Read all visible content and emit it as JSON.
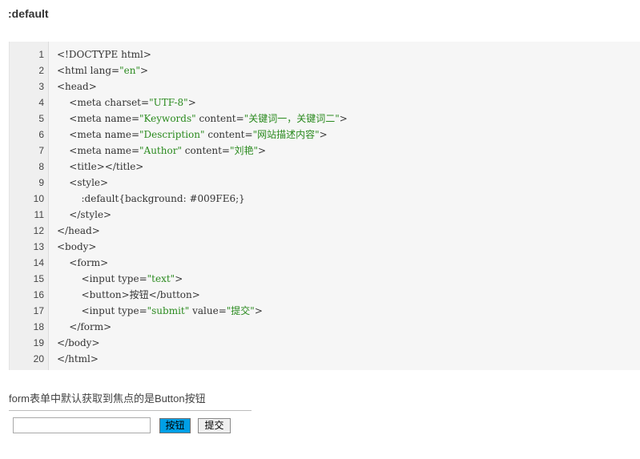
{
  "heading": ":default",
  "code_lines": [
    {
      "n": "1",
      "parts": [
        {
          "t": "<!DOCTYPE html>",
          "c": "tag"
        }
      ]
    },
    {
      "n": "2",
      "parts": [
        {
          "t": "<html lang=",
          "c": "tag"
        },
        {
          "t": "\"en\"",
          "c": "str"
        },
        {
          "t": ">",
          "c": "tag"
        }
      ]
    },
    {
      "n": "3",
      "parts": [
        {
          "t": "<head>",
          "c": "tag"
        }
      ]
    },
    {
      "n": "4",
      "parts": [
        {
          "t": "    <meta charset=",
          "c": "tag"
        },
        {
          "t": "\"UTF-8\"",
          "c": "str"
        },
        {
          "t": ">",
          "c": "tag"
        }
      ]
    },
    {
      "n": "5",
      "parts": [
        {
          "t": "    <meta name=",
          "c": "tag"
        },
        {
          "t": "\"Keywords\"",
          "c": "str"
        },
        {
          "t": " content=",
          "c": "tag"
        },
        {
          "t": "\"关键词一，关键词二\"",
          "c": "str"
        },
        {
          "t": ">",
          "c": "tag"
        }
      ]
    },
    {
      "n": "6",
      "parts": [
        {
          "t": "    <meta name=",
          "c": "tag"
        },
        {
          "t": "\"Description\"",
          "c": "str"
        },
        {
          "t": " content=",
          "c": "tag"
        },
        {
          "t": "\"网站描述内容\"",
          "c": "str"
        },
        {
          "t": ">",
          "c": "tag"
        }
      ]
    },
    {
      "n": "7",
      "parts": [
        {
          "t": "    <meta name=",
          "c": "tag"
        },
        {
          "t": "\"Author\"",
          "c": "str"
        },
        {
          "t": " content=",
          "c": "tag"
        },
        {
          "t": "\"刘艳\"",
          "c": "str"
        },
        {
          "t": ">",
          "c": "tag"
        }
      ]
    },
    {
      "n": "8",
      "parts": [
        {
          "t": "    <title></title>",
          "c": "tag"
        }
      ]
    },
    {
      "n": "9",
      "parts": [
        {
          "t": "    <style>",
          "c": "tag"
        }
      ]
    },
    {
      "n": "10",
      "parts": [
        {
          "t": "        :default{background: ",
          "c": "tag"
        },
        {
          "t": "#009FE6",
          "c": "hex"
        },
        {
          "t": ";}",
          "c": "tag"
        }
      ]
    },
    {
      "n": "11",
      "parts": [
        {
          "t": "    </style>",
          "c": "tag"
        }
      ]
    },
    {
      "n": "12",
      "parts": [
        {
          "t": "</head>",
          "c": "tag"
        }
      ]
    },
    {
      "n": "13",
      "parts": [
        {
          "t": "<body>",
          "c": "tag"
        }
      ]
    },
    {
      "n": "14",
      "parts": [
        {
          "t": "    <form>",
          "c": "tag"
        }
      ]
    },
    {
      "n": "15",
      "parts": [
        {
          "t": "        <input type=",
          "c": "tag"
        },
        {
          "t": "\"text\"",
          "c": "str"
        },
        {
          "t": ">",
          "c": "tag"
        }
      ]
    },
    {
      "n": "16",
      "parts": [
        {
          "t": "        <button>按钮</button>",
          "c": "tag"
        }
      ]
    },
    {
      "n": "17",
      "parts": [
        {
          "t": "        <input type=",
          "c": "tag"
        },
        {
          "t": "\"submit\"",
          "c": "str"
        },
        {
          "t": " value=",
          "c": "tag"
        },
        {
          "t": "\"提交\"",
          "c": "str"
        },
        {
          "t": ">",
          "c": "tag"
        }
      ]
    },
    {
      "n": "18",
      "parts": [
        {
          "t": "    </form>",
          "c": "tag"
        }
      ]
    },
    {
      "n": "19",
      "parts": [
        {
          "t": "</body>",
          "c": "tag"
        }
      ]
    },
    {
      "n": "20",
      "parts": [
        {
          "t": "</html>",
          "c": "tag"
        }
      ]
    }
  ],
  "description": "form表单中默认获取到焦点的是Button按钮",
  "demo": {
    "input_value": "",
    "button_label": "按钮",
    "submit_label": "提交"
  },
  "colors": {
    "default_bg": "#009FE6",
    "string": "#2a8a1e"
  }
}
